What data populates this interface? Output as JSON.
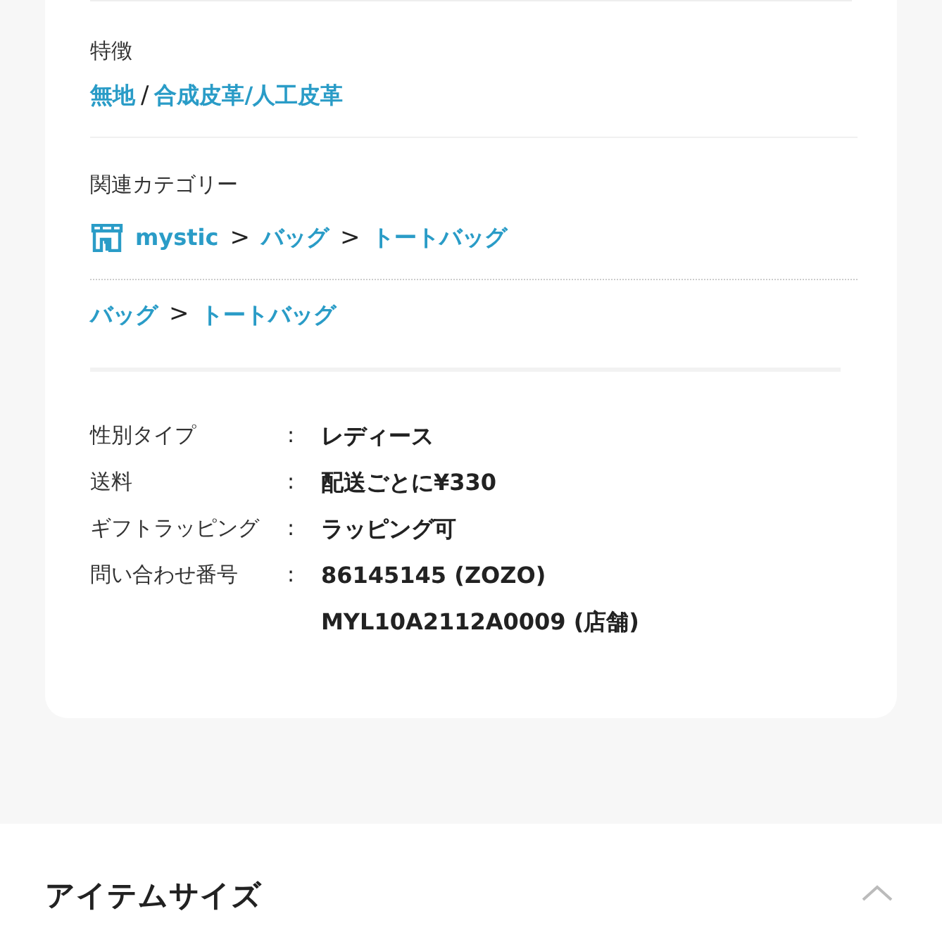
{
  "features": {
    "label": "特徴",
    "parts": [
      {
        "kind": "link",
        "text": "無地"
      },
      {
        "kind": "sep",
        "text": "/"
      },
      {
        "kind": "link",
        "text": "合成皮革/人工皮革"
      }
    ]
  },
  "categories": {
    "label": "関連カテゴリー",
    "paths": [
      {
        "shop_icon": true,
        "parts": [
          {
            "kind": "link",
            "text": "mystic"
          },
          {
            "kind": "sep",
            "text": ">"
          },
          {
            "kind": "link",
            "text": "バッグ"
          },
          {
            "kind": "sep",
            "text": ">"
          },
          {
            "kind": "link",
            "text": "トートバッグ"
          }
        ]
      },
      {
        "shop_icon": false,
        "parts": [
          {
            "kind": "link",
            "text": "バッグ"
          },
          {
            "kind": "sep",
            "text": ">"
          },
          {
            "kind": "link",
            "text": "トートバッグ"
          }
        ]
      }
    ]
  },
  "specs": [
    {
      "label": "性別タイプ",
      "colon": ":",
      "values": [
        "レディース"
      ]
    },
    {
      "label": "送料",
      "colon": ":",
      "values": [
        "配送ごとに¥330"
      ]
    },
    {
      "label": "ギフトラッピング",
      "colon": ":",
      "values": [
        "ラッピング可"
      ]
    },
    {
      "label": "問い合わせ番号",
      "colon": ":",
      "values": [
        "86145145 (ZOZO)",
        "MYL10A2112A0009 (店舗)"
      ]
    }
  ],
  "section": {
    "title": "アイテムサイズ",
    "expanded": true
  }
}
